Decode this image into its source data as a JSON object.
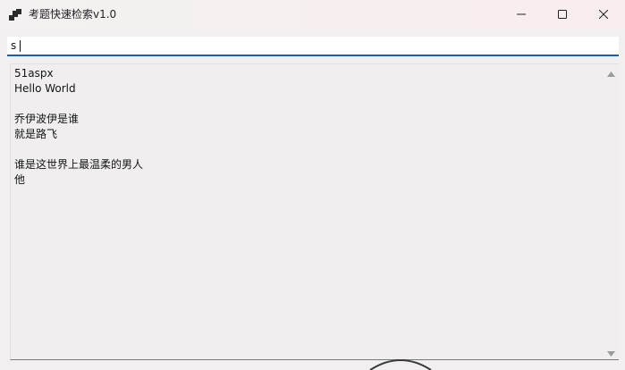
{
  "window": {
    "title": "考题快速检索v1.0",
    "icons": {
      "app": "app-icon",
      "minimize": "minimize-icon",
      "maximize": "maximize-icon",
      "close": "close-icon"
    }
  },
  "search": {
    "value": "s",
    "placeholder": ""
  },
  "results": {
    "text": "51aspx\nHello World\n\n乔伊波伊是谁\n就是路飞\n\n谁是这世界上最温柔的男人\n他"
  },
  "colors": {
    "focus_underline": "#1f5fa8",
    "background": "#f0eeee"
  }
}
